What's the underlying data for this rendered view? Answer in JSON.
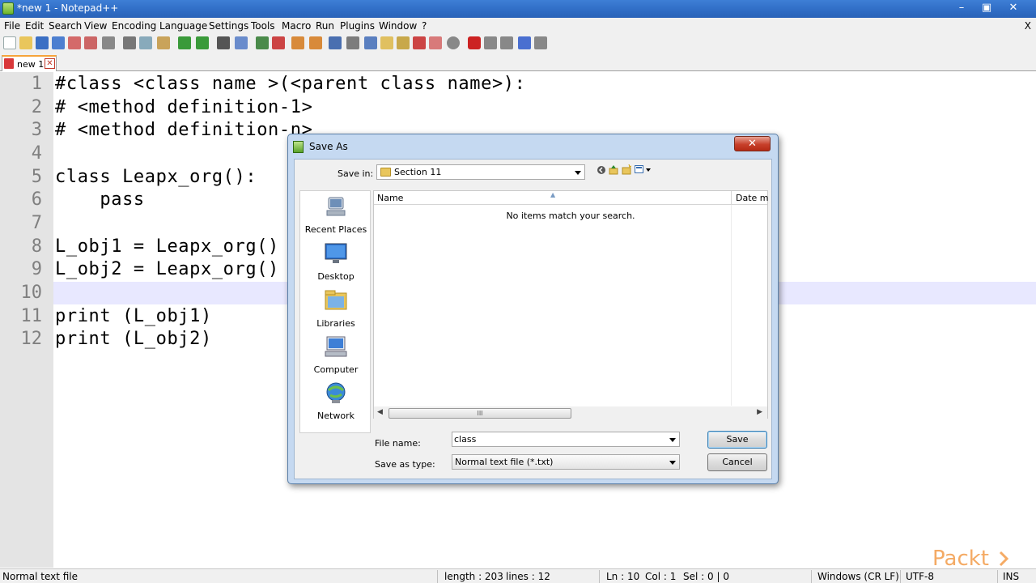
{
  "window": {
    "title": "*new 1 - Notepad++",
    "controls": {
      "minimize": "–",
      "maximize": "▣",
      "close": "✕"
    }
  },
  "menu": {
    "items": [
      "File",
      "Edit",
      "Search",
      "View",
      "Encoding",
      "Language",
      "Settings",
      "Tools",
      "Macro",
      "Run",
      "Plugins",
      "Window",
      "?"
    ],
    "close_doc": "X"
  },
  "tab": {
    "label": "new 1",
    "close": "✕"
  },
  "editor": {
    "line_numbers": [
      "1",
      "2",
      "3",
      "4",
      "5",
      "6",
      "7",
      "8",
      "9",
      "10",
      "11",
      "12"
    ],
    "lines": [
      "#class <class name >(<parent class name>):",
      "# <method definition-1>",
      "# <method definition-n>",
      "",
      "class Leapx_org():",
      "    pass",
      "",
      "L_obj1 = Leapx_org()",
      "L_obj2 = Leapx_org()",
      "",
      "print (L_obj1)",
      "print (L_obj2)"
    ],
    "current_line": 10
  },
  "status": {
    "file_type": "Normal text file",
    "length": "length : 203",
    "lines": "lines : 12",
    "ln": "Ln : 10",
    "col": "Col : 1",
    "sel": "Sel : 0 | 0",
    "eol": "Windows (CR LF)",
    "encoding": "UTF-8",
    "mode": "INS"
  },
  "dialog": {
    "title": "Save As",
    "close": "✕",
    "save_in_label": "Save in:",
    "save_in_value": "Section 11",
    "places": [
      "Recent Places",
      "Desktop",
      "Libraries",
      "Computer",
      "Network"
    ],
    "columns": {
      "name": "Name",
      "date": "Date m"
    },
    "empty_message": "No items match your search.",
    "scroll_thumb": "III",
    "file_name_label": "File name:",
    "file_name_value": "class",
    "save_type_label": "Save as type:",
    "save_type_value": "Normal text file (*.txt)",
    "save_button": "Save",
    "cancel_button": "Cancel"
  },
  "watermark": "Packt>",
  "colors": {
    "accent": "#f6a43b",
    "titlebar": "#2f6cc4",
    "current_line": "#e8e8ff"
  }
}
